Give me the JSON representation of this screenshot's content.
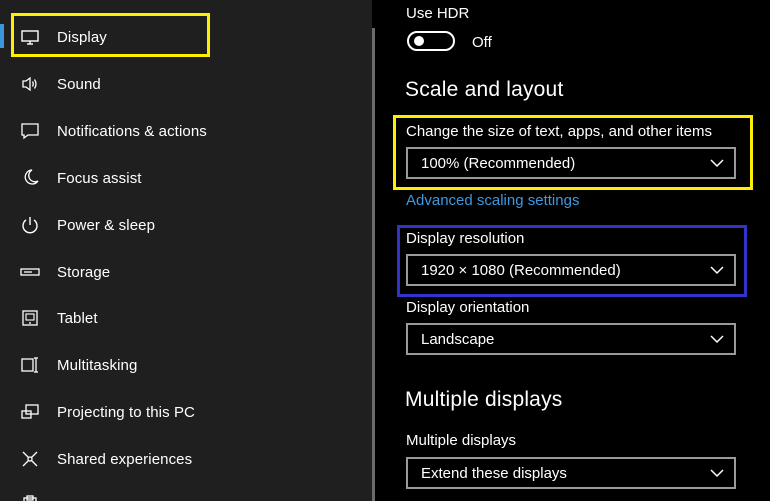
{
  "sidebar": {
    "items": [
      {
        "label": "Display",
        "icon": "monitor-icon"
      },
      {
        "label": "Sound",
        "icon": "speaker-icon"
      },
      {
        "label": "Notifications & actions",
        "icon": "notification-icon"
      },
      {
        "label": "Focus assist",
        "icon": "moon-icon"
      },
      {
        "label": "Power & sleep",
        "icon": "power-icon"
      },
      {
        "label": "Storage",
        "icon": "storage-icon"
      },
      {
        "label": "Tablet",
        "icon": "tablet-icon"
      },
      {
        "label": "Multitasking",
        "icon": "multitasking-icon"
      },
      {
        "label": "Projecting to this PC",
        "icon": "projecting-icon"
      },
      {
        "label": "Shared experiences",
        "icon": "shared-experiences-icon"
      }
    ],
    "active_index": 0
  },
  "content": {
    "hdr": {
      "label": "Use HDR",
      "state_label": "Off",
      "is_on": false
    },
    "scale_heading": "Scale and layout",
    "scale": {
      "label": "Change the size of text, apps, and other items",
      "value": "100% (Recommended)"
    },
    "advanced_link": "Advanced scaling settings",
    "resolution": {
      "label": "Display resolution",
      "value": "1920 × 1080 (Recommended)"
    },
    "orientation": {
      "label": "Display orientation",
      "value": "Landscape"
    },
    "multiple_heading": "Multiple displays",
    "multiple": {
      "label": "Multiple displays",
      "value": "Extend these displays"
    }
  },
  "colors": {
    "accent": "#3a96dd",
    "link": "#3b9ae1",
    "highlight_yellow": "#ffee00",
    "highlight_blue": "#3333cc",
    "sidebar_bg": "#1f1f1f",
    "content_bg": "#000000"
  }
}
